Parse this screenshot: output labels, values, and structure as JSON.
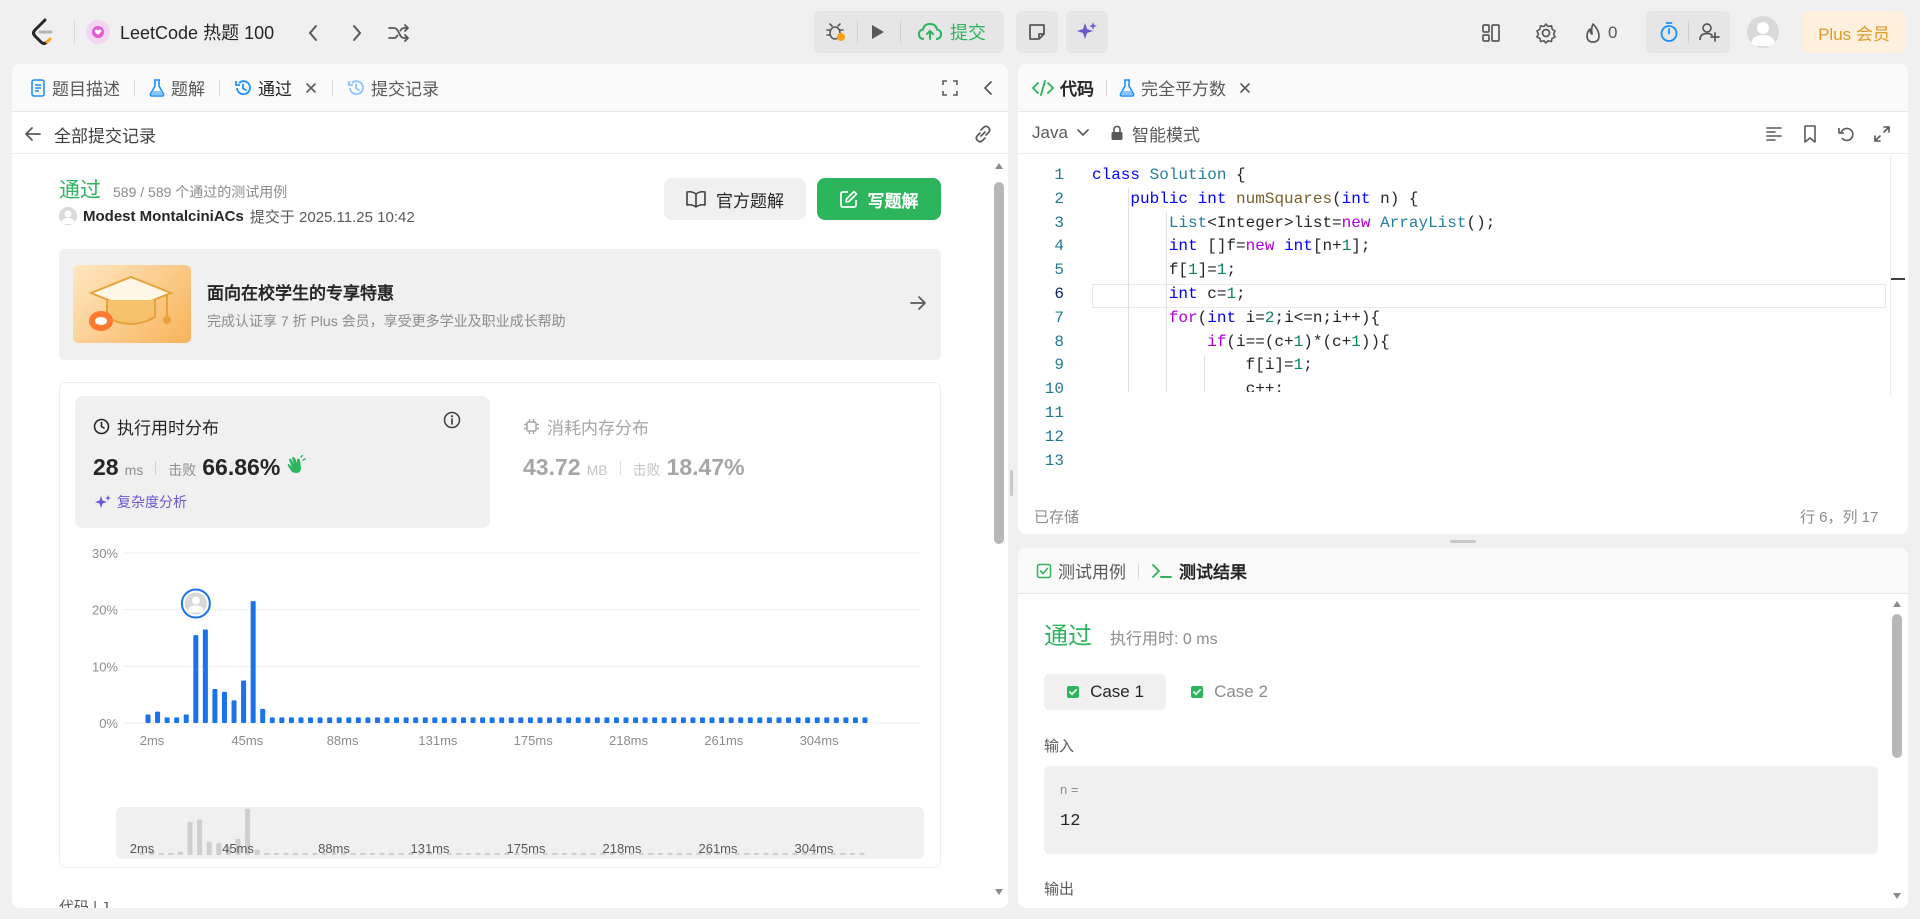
{
  "topbar": {
    "problem_list_title": "LeetCode 热题 100",
    "submit_label": "提交",
    "streak_count": "0",
    "plus_label": "Plus 会员"
  },
  "left_panel": {
    "tabs": [
      {
        "label": "题目描述"
      },
      {
        "label": "题解"
      },
      {
        "label": "通过"
      },
      {
        "label": "提交记录"
      }
    ],
    "back_label": "全部提交记录",
    "status": "通过",
    "testcases": "589 / 589 个通过的测试用例",
    "user": "Modest MontalciniACs",
    "submitted_at": "提交于 2025.11.25 10:42",
    "official_solution_label": "官方题解",
    "write_solution_label": "写题解",
    "promo": {
      "title": "面向在校学生的专享特惠",
      "subtitle": "完成认证享 7 折 Plus 会员，享受更多学业及职业成长帮助"
    },
    "runtime": {
      "title": "执行用时分布",
      "value": "28",
      "unit": "ms",
      "beats_label": "击败",
      "beats": "66.86%",
      "complexity_label": "复杂度分析"
    },
    "memory": {
      "title": "消耗内存分布",
      "value": "43.72",
      "unit": "MB",
      "beats_label": "击败",
      "beats": "18.47%"
    },
    "bottom_cut_label": "代码 | J"
  },
  "chart_data": {
    "type": "bar",
    "y_ticks": [
      "30%",
      "20%",
      "10%",
      "0%"
    ],
    "ylim": [
      0,
      30
    ],
    "x_ticks": [
      "2ms",
      "45ms",
      "88ms",
      "131ms",
      "175ms",
      "218ms",
      "261ms",
      "304ms"
    ],
    "values": [
      1.5,
      2,
      1,
      1,
      1.5,
      15.5,
      16.5,
      6,
      5.5,
      4,
      7.5,
      21.5,
      2.5,
      1,
      1,
      1,
      1,
      1,
      1,
      1,
      1,
      1,
      1,
      1,
      1,
      1,
      1,
      1,
      1,
      1,
      1,
      1,
      1,
      1,
      1,
      1,
      1,
      1,
      1,
      1,
      1,
      1,
      1,
      1,
      1,
      1,
      1,
      1,
      1,
      1,
      1,
      1,
      1,
      1,
      1,
      1,
      1,
      1,
      1,
      1,
      1,
      1,
      1,
      1,
      1,
      1,
      1,
      1,
      1,
      1,
      1,
      1,
      1,
      1,
      1,
      1
    ],
    "highlight_index": 6,
    "color": "#1a73e8",
    "overview_color": "#cfcfcf"
  },
  "code_panel": {
    "tab_code": "代码",
    "tab_problem": "完全平方数",
    "language": "Java",
    "mode": "智能模式",
    "saved": "已存储",
    "cursor": "行 6，列 17",
    "line_numbers": [
      "1",
      "2",
      "3",
      "4",
      "5",
      "6",
      "7",
      "8",
      "9",
      "10",
      "11",
      "12",
      "13"
    ]
  },
  "test_panel": {
    "tab_cases": "测试用例",
    "tab_results": "测试结果",
    "status": "通过",
    "runtime": "执行用时: 0 ms",
    "cases": [
      "Case 1",
      "Case 2"
    ],
    "input_label": "输入",
    "input_var": "n =",
    "input_value": "12",
    "output_label": "输出"
  },
  "colors": {
    "accent_green": "#2db55d",
    "accent_blue": "#1a73e8",
    "plus_bg": "#fdf0dd",
    "plus_text": "#e09a2c"
  }
}
